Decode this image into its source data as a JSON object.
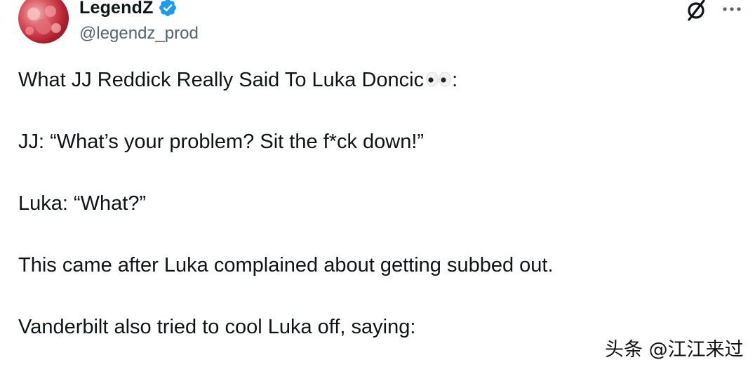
{
  "author": {
    "display_name": "LegendZ",
    "handle": "@legendz_prod",
    "verified": true,
    "verified_color": "#1d9bf0"
  },
  "header_icons": [
    "grok-icon",
    "more-options-icon"
  ],
  "tweet": {
    "line1": "What JJ Reddick Really Said To Luka Doncic",
    "line1_emoji": "eyes-emoji",
    "line1_suffix": ":",
    "line2": "JJ: “What’s your problem? Sit the f*ck down!”",
    "line3": "Luka: “What?”",
    "line4": "This came after Luka complained about getting subbed out.",
    "line5": "Vanderbilt also tried to cool Luka off, saying:"
  },
  "watermark": "头条 @江江来过"
}
